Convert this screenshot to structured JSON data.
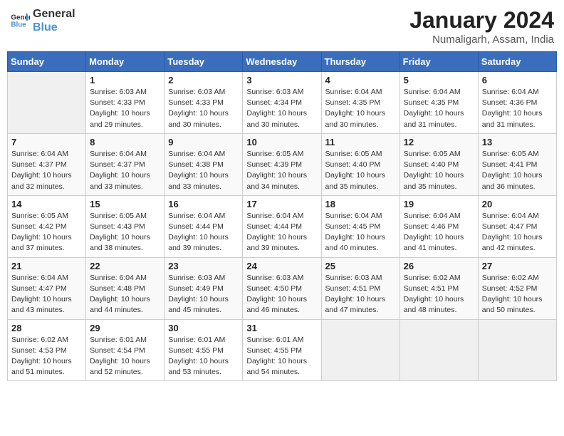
{
  "logo": {
    "line1": "General",
    "line2": "Blue"
  },
  "title": "January 2024",
  "subtitle": "Numaligarh, Assam, India",
  "days_header": [
    "Sunday",
    "Monday",
    "Tuesday",
    "Wednesday",
    "Thursday",
    "Friday",
    "Saturday"
  ],
  "weeks": [
    [
      {
        "day": "",
        "info": ""
      },
      {
        "day": "1",
        "info": "Sunrise: 6:03 AM\nSunset: 4:33 PM\nDaylight: 10 hours\nand 29 minutes."
      },
      {
        "day": "2",
        "info": "Sunrise: 6:03 AM\nSunset: 4:33 PM\nDaylight: 10 hours\nand 30 minutes."
      },
      {
        "day": "3",
        "info": "Sunrise: 6:03 AM\nSunset: 4:34 PM\nDaylight: 10 hours\nand 30 minutes."
      },
      {
        "day": "4",
        "info": "Sunrise: 6:04 AM\nSunset: 4:35 PM\nDaylight: 10 hours\nand 30 minutes."
      },
      {
        "day": "5",
        "info": "Sunrise: 6:04 AM\nSunset: 4:35 PM\nDaylight: 10 hours\nand 31 minutes."
      },
      {
        "day": "6",
        "info": "Sunrise: 6:04 AM\nSunset: 4:36 PM\nDaylight: 10 hours\nand 31 minutes."
      }
    ],
    [
      {
        "day": "7",
        "info": "Sunrise: 6:04 AM\nSunset: 4:37 PM\nDaylight: 10 hours\nand 32 minutes."
      },
      {
        "day": "8",
        "info": "Sunrise: 6:04 AM\nSunset: 4:37 PM\nDaylight: 10 hours\nand 33 minutes."
      },
      {
        "day": "9",
        "info": "Sunrise: 6:04 AM\nSunset: 4:38 PM\nDaylight: 10 hours\nand 33 minutes."
      },
      {
        "day": "10",
        "info": "Sunrise: 6:05 AM\nSunset: 4:39 PM\nDaylight: 10 hours\nand 34 minutes."
      },
      {
        "day": "11",
        "info": "Sunrise: 6:05 AM\nSunset: 4:40 PM\nDaylight: 10 hours\nand 35 minutes."
      },
      {
        "day": "12",
        "info": "Sunrise: 6:05 AM\nSunset: 4:40 PM\nDaylight: 10 hours\nand 35 minutes."
      },
      {
        "day": "13",
        "info": "Sunrise: 6:05 AM\nSunset: 4:41 PM\nDaylight: 10 hours\nand 36 minutes."
      }
    ],
    [
      {
        "day": "14",
        "info": "Sunrise: 6:05 AM\nSunset: 4:42 PM\nDaylight: 10 hours\nand 37 minutes."
      },
      {
        "day": "15",
        "info": "Sunrise: 6:05 AM\nSunset: 4:43 PM\nDaylight: 10 hours\nand 38 minutes."
      },
      {
        "day": "16",
        "info": "Sunrise: 6:04 AM\nSunset: 4:44 PM\nDaylight: 10 hours\nand 39 minutes."
      },
      {
        "day": "17",
        "info": "Sunrise: 6:04 AM\nSunset: 4:44 PM\nDaylight: 10 hours\nand 39 minutes."
      },
      {
        "day": "18",
        "info": "Sunrise: 6:04 AM\nSunset: 4:45 PM\nDaylight: 10 hours\nand 40 minutes."
      },
      {
        "day": "19",
        "info": "Sunrise: 6:04 AM\nSunset: 4:46 PM\nDaylight: 10 hours\nand 41 minutes."
      },
      {
        "day": "20",
        "info": "Sunrise: 6:04 AM\nSunset: 4:47 PM\nDaylight: 10 hours\nand 42 minutes."
      }
    ],
    [
      {
        "day": "21",
        "info": "Sunrise: 6:04 AM\nSunset: 4:47 PM\nDaylight: 10 hours\nand 43 minutes."
      },
      {
        "day": "22",
        "info": "Sunrise: 6:04 AM\nSunset: 4:48 PM\nDaylight: 10 hours\nand 44 minutes."
      },
      {
        "day": "23",
        "info": "Sunrise: 6:03 AM\nSunset: 4:49 PM\nDaylight: 10 hours\nand 45 minutes."
      },
      {
        "day": "24",
        "info": "Sunrise: 6:03 AM\nSunset: 4:50 PM\nDaylight: 10 hours\nand 46 minutes."
      },
      {
        "day": "25",
        "info": "Sunrise: 6:03 AM\nSunset: 4:51 PM\nDaylight: 10 hours\nand 47 minutes."
      },
      {
        "day": "26",
        "info": "Sunrise: 6:02 AM\nSunset: 4:51 PM\nDaylight: 10 hours\nand 48 minutes."
      },
      {
        "day": "27",
        "info": "Sunrise: 6:02 AM\nSunset: 4:52 PM\nDaylight: 10 hours\nand 50 minutes."
      }
    ],
    [
      {
        "day": "28",
        "info": "Sunrise: 6:02 AM\nSunset: 4:53 PM\nDaylight: 10 hours\nand 51 minutes."
      },
      {
        "day": "29",
        "info": "Sunrise: 6:01 AM\nSunset: 4:54 PM\nDaylight: 10 hours\nand 52 minutes."
      },
      {
        "day": "30",
        "info": "Sunrise: 6:01 AM\nSunset: 4:55 PM\nDaylight: 10 hours\nand 53 minutes."
      },
      {
        "day": "31",
        "info": "Sunrise: 6:01 AM\nSunset: 4:55 PM\nDaylight: 10 hours\nand 54 minutes."
      },
      {
        "day": "",
        "info": ""
      },
      {
        "day": "",
        "info": ""
      },
      {
        "day": "",
        "info": ""
      }
    ]
  ]
}
